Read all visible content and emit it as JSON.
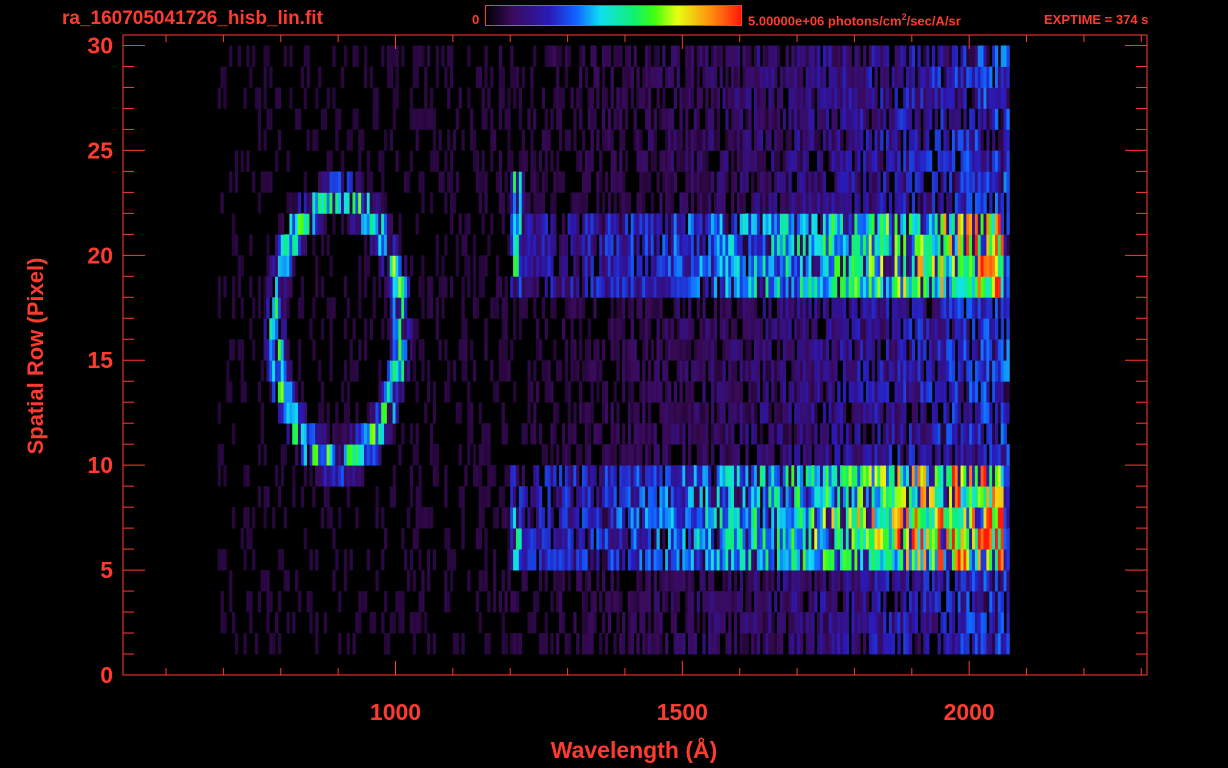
{
  "header": {
    "filename": "ra_160705041726_hisb_lin.fit",
    "colorbar_min": "0",
    "colorbar_max_prefix": "5.00000e+06 photons/cm",
    "colorbar_max_sup": "2",
    "colorbar_max_suffix": "/sec/A/sr",
    "exptime": "EXPTIME = 374 s"
  },
  "colors": {
    "axis": "#ff3b2f",
    "background": "#000000",
    "colormap": [
      "#000000",
      "#3a0a5a",
      "#2a1ab8",
      "#1060ff",
      "#10e0f0",
      "#10f070",
      "#40ff10",
      "#e8ff10",
      "#ff9010",
      "#ff1a0a"
    ]
  },
  "chart_data": {
    "type": "heatmap",
    "title": "ra_160705041726_hisb_lin.fit",
    "xlabel": "Wavelength (Å)",
    "ylabel": "Spatial Row (Pixel)",
    "xlim": [
      525,
      2310
    ],
    "ylim": [
      0,
      30.5
    ],
    "xticks": [
      1000,
      1500,
      2000
    ],
    "yticks": [
      0,
      5,
      10,
      15,
      20,
      25,
      30
    ],
    "colorbar": {
      "min": 0,
      "max": 5000000,
      "units": "photons/cm²/sec/A/sr"
    },
    "data_extent": {
      "wavelength": [
        690,
        2070
      ],
      "rows": [
        1,
        30
      ]
    },
    "features": [
      {
        "name": "ring",
        "center_wavelength": 900,
        "center_row": 16.5,
        "half_width": 110,
        "half_height": 6.2,
        "level": 0.55
      },
      {
        "name": "line_1216_upper",
        "wavelength": 1212,
        "rows": [
          18,
          24
        ],
        "level": 0.55
      },
      {
        "name": "line_1216_lower",
        "wavelength": 1212,
        "rows": [
          5,
          8
        ],
        "level": 0.6
      },
      {
        "name": "continuum_upper",
        "wavelength_range": [
          1200,
          2060
        ],
        "rows": [
          18,
          22
        ],
        "peak_level": 0.6
      },
      {
        "name": "continuum_lower",
        "wavelength_range": [
          1200,
          2060
        ],
        "rows": [
          5,
          10
        ],
        "peak_level": 0.8
      }
    ]
  }
}
